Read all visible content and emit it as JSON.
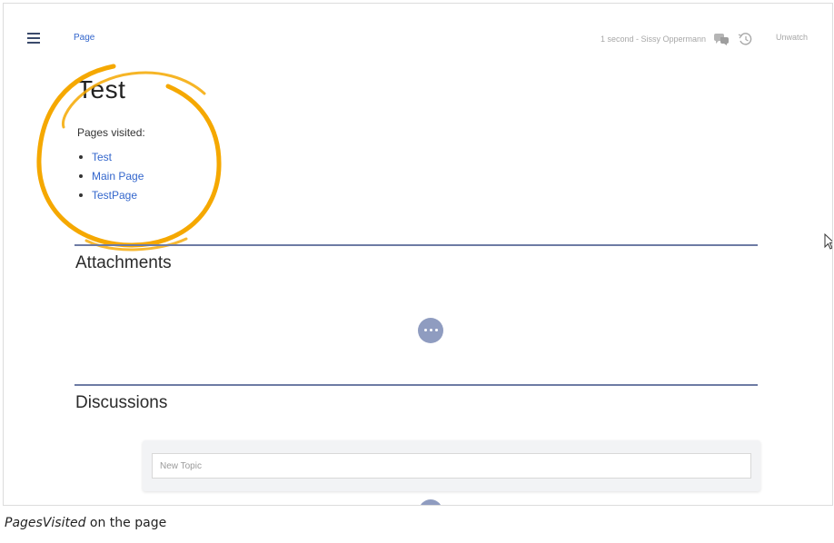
{
  "header": {
    "tab_label": "Page",
    "revision_info": "1 second - Sissy Oppermann",
    "unwatch_label": "Unwatch"
  },
  "article": {
    "title": "Test",
    "pages_visited_label": "Pages visited:",
    "visited_pages": [
      "Test",
      "Main Page",
      "TestPage"
    ]
  },
  "sections": {
    "attachments_title": "Attachments",
    "discussions_title": "Discussions",
    "new_topic_placeholder": "New Topic"
  },
  "caption": {
    "emphasis": "PagesVisited",
    "rest": " on the page"
  },
  "colors": {
    "accent_link": "#3366cc",
    "section_rule": "#6d7ba4",
    "action_button": "#8f9cc0",
    "highlight_circle": "#f5a800"
  },
  "icons": {
    "menu": "hamburger-icon",
    "comments": "speech-bubbles-icon",
    "history": "history-icon",
    "more": "ellipsis-icon",
    "cursor": "mouse-pointer-icon"
  }
}
